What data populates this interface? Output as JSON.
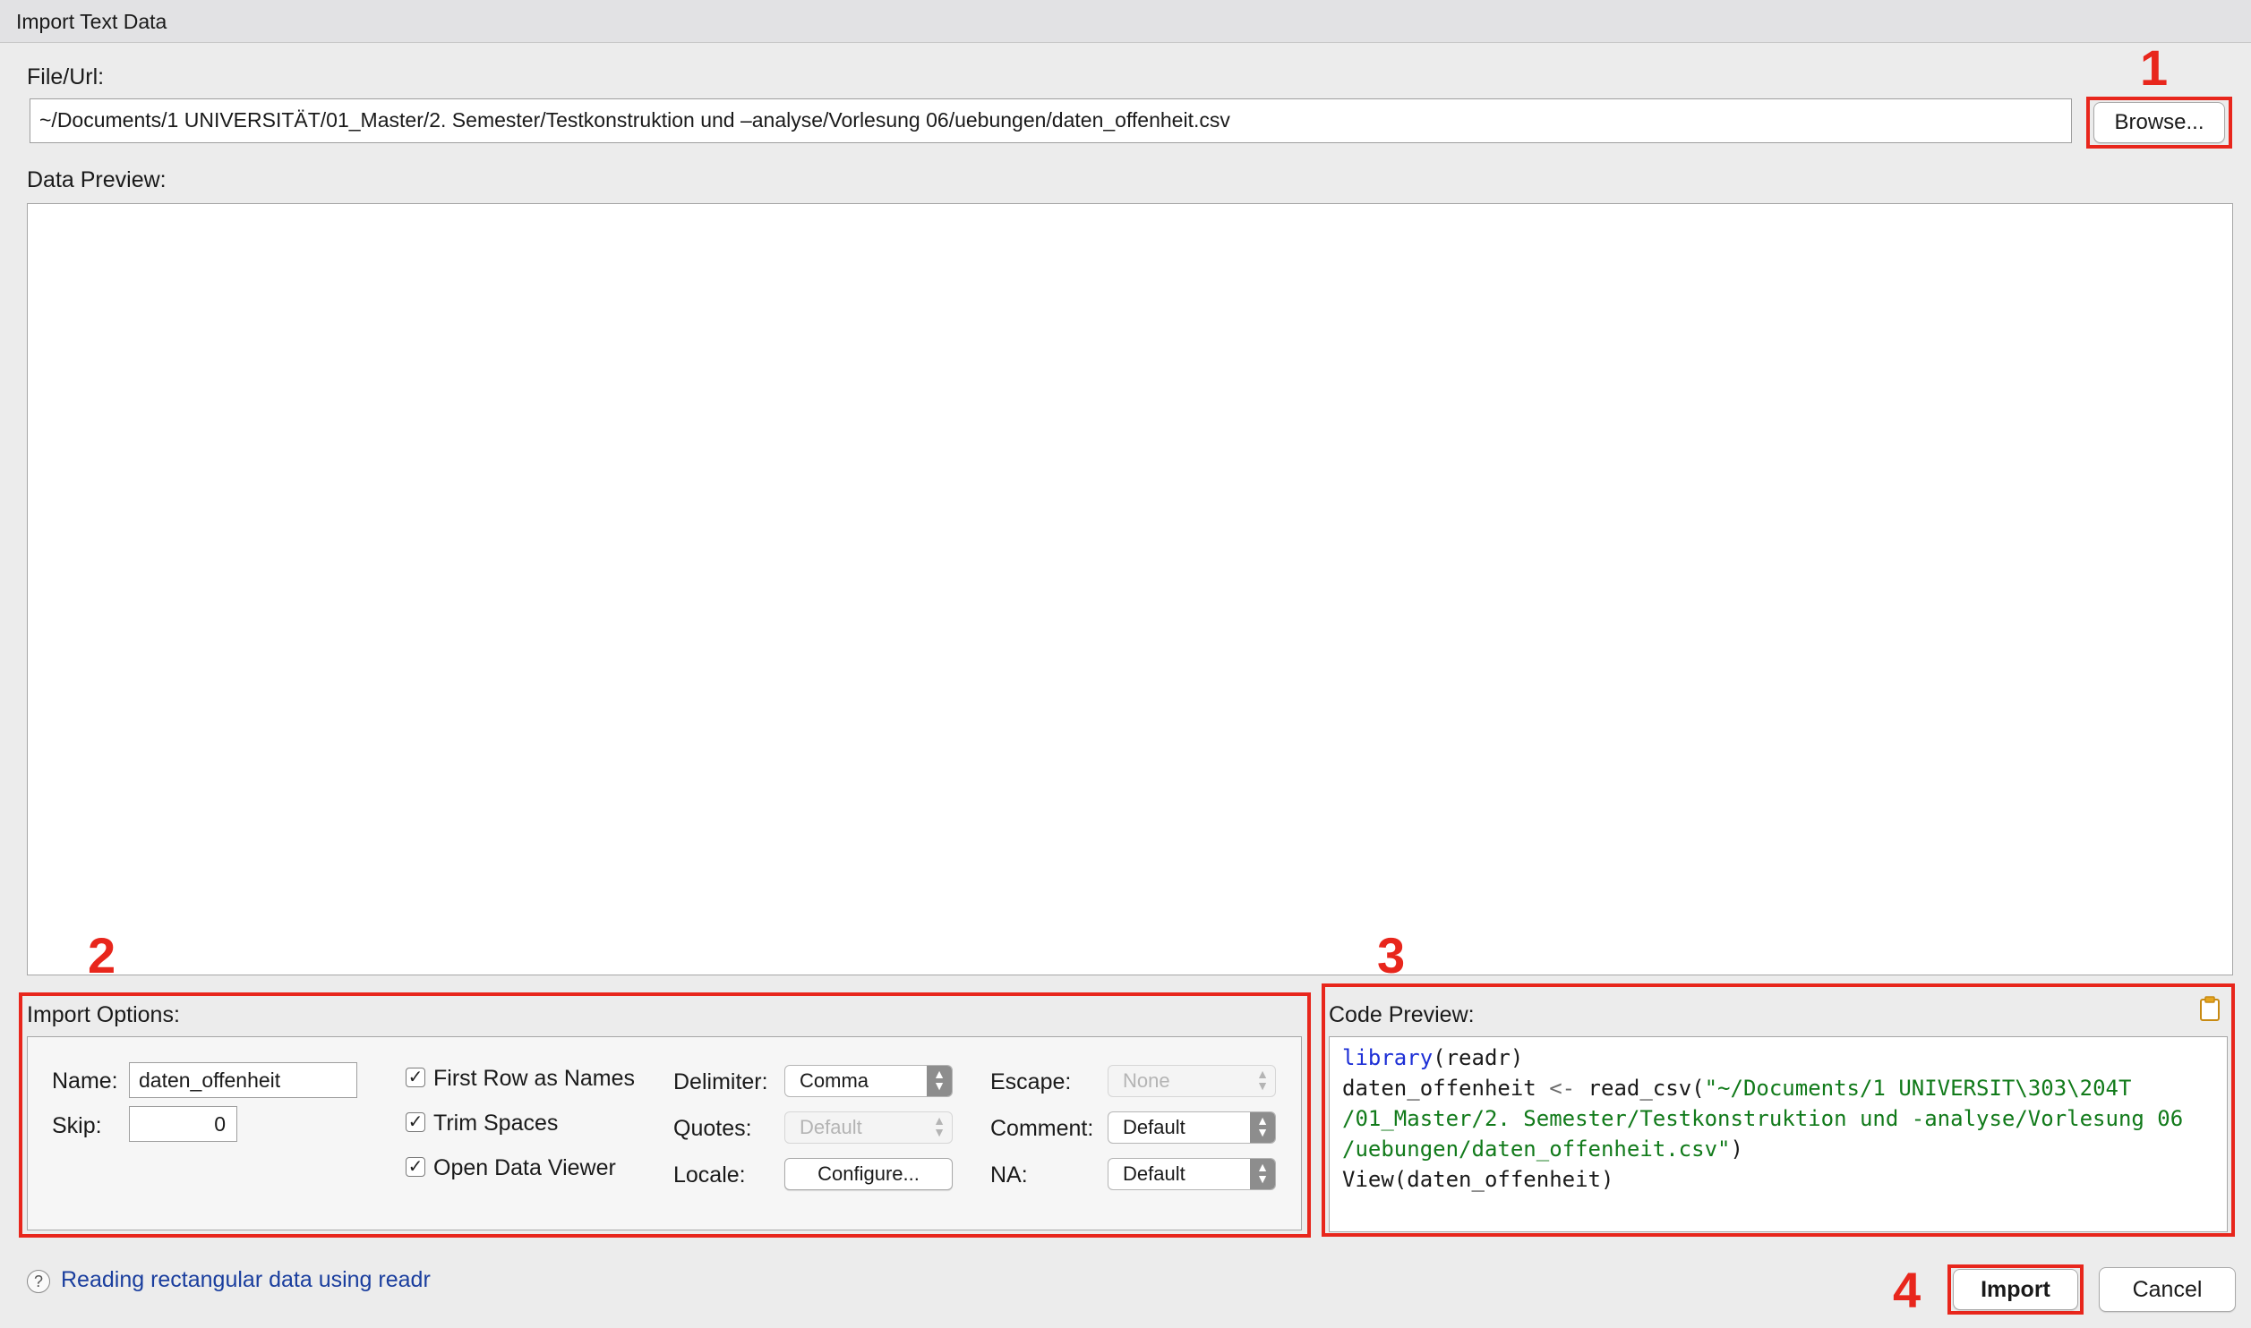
{
  "window": {
    "title": "Import Text Data"
  },
  "file": {
    "label": "File/Url:",
    "value": "~/Documents/1 UNIVERSITÄT/01_Master/2. Semester/Testkonstruktion und –analyse/Vorlesung 06/uebungen/daten_offenheit.csv",
    "browse_label": "Browse..."
  },
  "preview": {
    "label": "Data Preview:"
  },
  "annotations": {
    "a1": "1",
    "a2": "2",
    "a3": "3",
    "a4": "4"
  },
  "import_options": {
    "label": "Import Options:",
    "name_label": "Name:",
    "name_value": "daten_offenheit",
    "skip_label": "Skip:",
    "skip_value": "0",
    "first_row": {
      "label": "First Row as Names",
      "checked": true
    },
    "trim_spaces": {
      "label": "Trim Spaces",
      "checked": true
    },
    "open_viewer": {
      "label": "Open Data Viewer",
      "checked": true
    },
    "delimiter_label": "Delimiter:",
    "delimiter_value": "Comma",
    "quotes_label": "Quotes:",
    "quotes_value": "Default",
    "locale_label": "Locale:",
    "locale_button": "Configure...",
    "escape_label": "Escape:",
    "escape_value": "None",
    "comment_label": "Comment:",
    "comment_value": "Default",
    "na_label": "NA:",
    "na_value": "Default"
  },
  "code_preview": {
    "label": "Code Preview:",
    "l1_fn": "library",
    "l1_rest": "(readr)",
    "l2_a": "daten_offenheit ",
    "l2_op": "<-",
    "l2_b": " read_csv(",
    "l2_str": "\"~/Documents/1 UNIVERSIT\\303\\204T",
    "l3_str": "/01_Master/2. Semester/Testkonstruktion und -analyse/Vorlesung 06",
    "l4_str": "/uebungen/daten_offenheit.csv\"",
    "l4_end": ")",
    "l5": "View(daten_offenheit)"
  },
  "footer": {
    "help_link": "Reading rectangular data using readr",
    "import_label": "Import",
    "cancel_label": "Cancel"
  },
  "colors": {
    "annotation_red": "#e8261c",
    "link_blue": "#1a3e9e",
    "keyword_blue": "#1d2fd6",
    "string_green": "#117a1a"
  }
}
